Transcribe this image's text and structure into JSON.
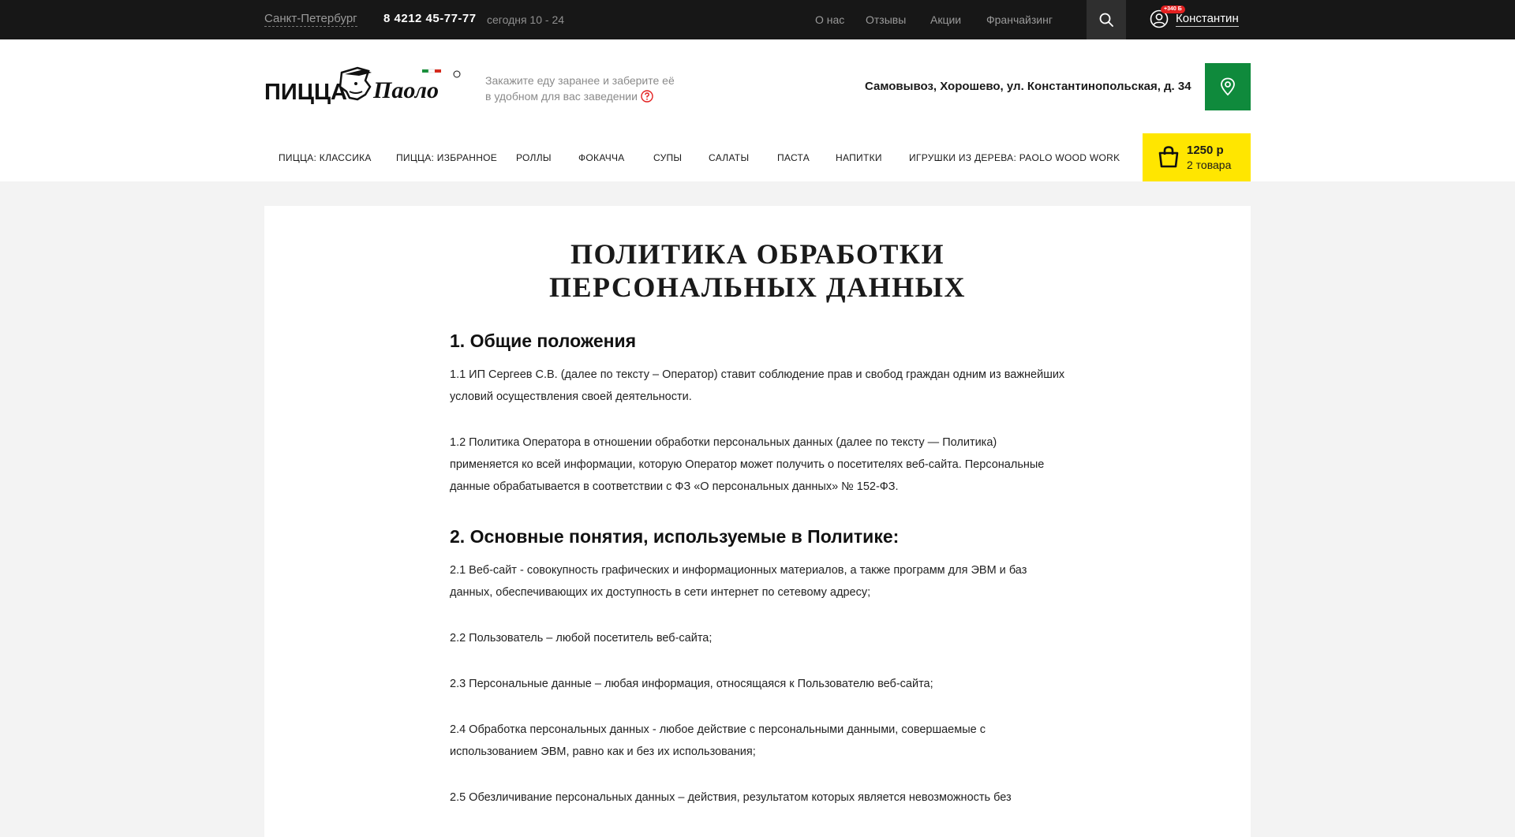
{
  "topbar": {
    "city": "Санкт-Петербург",
    "phone": "8 4212 45-77-77",
    "hours": "сегодня 10 - 24",
    "nav": [
      "О нас",
      "Отзывы",
      "Акции",
      "Франчайзинг"
    ],
    "badge": "+340 Б",
    "username": "Константин"
  },
  "header": {
    "hint_line1": "Закажите еду заранее и заберите её",
    "hint_line2": "в удобном для вас заведении",
    "address": "Самовывоз, Хорошево, ул. Константинопольская, д. 34"
  },
  "menu": [
    "ПИЦЦА: КЛАССИКА",
    "ПИЦЦА: ИЗБРАННОЕ",
    "РОЛЛЫ",
    "ФОКАЧЧА",
    "СУПЫ",
    "САЛАТЫ",
    "ПАСТА",
    "НАПИТКИ",
    "ИГРУШКИ ИЗ ДЕРЕВА: PAOLO WOOD WORK"
  ],
  "cart": {
    "sum": "1250 р",
    "count": "2 товара"
  },
  "page": {
    "title_line1": "ПОЛИТИКА ОБРАБОТКИ",
    "title_line2": "ПЕРСОНАЛЬНЫХ ДАННЫХ",
    "section1": "1. Общие положения",
    "p1_1": "1.1 ИП Сергеев С.В. (далее по тексту – Оператор) ставит соблюдение прав и свобод граждан одним из важнейших условий осуществления своей деятельности.",
    "p1_2": "1.2 Политика Оператора в отношении обработки персональных данных (далее по тексту — Политика) применяется ко всей информации, которую Оператор может получить о посетителях веб-сайта. Персональные данные обрабатывается в соответствии с ФЗ «О персональных данных» № 152-ФЗ.",
    "section2": "2. Основные понятия, используемые в Политике:",
    "p2_1": "2.1 Веб-сайт - совокупность графических и информационных материалов, а также программ для ЭВМ и баз данных, обеспечивающих их доступность в сети интернет по сетевому адресу;",
    "p2_2": "2.2 Пользователь – любой посетитель веб-сайта;",
    "p2_3": "2.3 Персональные данные – любая информация, относящаяся к Пользователю веб-сайта;",
    "p2_4": "2.4 Обработка персональных данных - любое действие с персональными данными, совершаемые с использованием ЭВМ, равно как и без их использования;",
    "p2_5": "2.5 Обезличивание персональных данных – действия, результатом которых является невозможность без"
  }
}
